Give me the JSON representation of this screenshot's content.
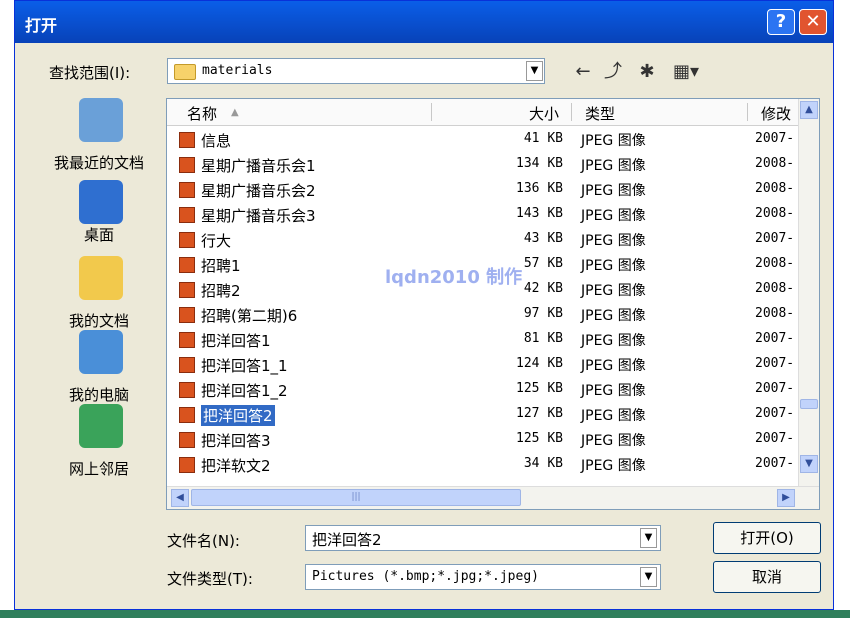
{
  "window": {
    "title": "打开",
    "help_label": "?",
    "close_label": "✕"
  },
  "look_in": {
    "label": "查找范围(I):",
    "value": "materials"
  },
  "toolbar": {
    "back_icon": "back-arrow-icon",
    "up_icon": "up-folder-icon",
    "new_folder_icon": "new-folder-icon",
    "view_icon": "view-menu-icon"
  },
  "places": [
    {
      "label": "我最近的文档",
      "icon": "recent-docs-icon",
      "color": "#6aa0d8"
    },
    {
      "label": "桌面",
      "icon": "desktop-icon",
      "color": "#2f6fd0"
    },
    {
      "label": "我的文档",
      "icon": "my-documents-icon",
      "color": "#f2c94c"
    },
    {
      "label": "我的电脑",
      "icon": "my-computer-icon",
      "color": "#4a8fd8"
    },
    {
      "label": "网上邻居",
      "icon": "network-icon",
      "color": "#3aa35a"
    }
  ],
  "columns": {
    "name": "名称",
    "size": "大小",
    "type": "类型",
    "modified": "修改"
  },
  "files": [
    {
      "name": "信息",
      "size": "41 KB",
      "type": "JPEG 图像",
      "date": "2007-"
    },
    {
      "name": "星期广播音乐会1",
      "size": "134 KB",
      "type": "JPEG 图像",
      "date": "2008-"
    },
    {
      "name": "星期广播音乐会2",
      "size": "136 KB",
      "type": "JPEG 图像",
      "date": "2008-"
    },
    {
      "name": "星期广播音乐会3",
      "size": "143 KB",
      "type": "JPEG 图像",
      "date": "2008-"
    },
    {
      "name": "行大",
      "size": "43 KB",
      "type": "JPEG 图像",
      "date": "2007-"
    },
    {
      "name": "招聘1",
      "size": "57 KB",
      "type": "JPEG 图像",
      "date": "2008-"
    },
    {
      "name": "招聘2",
      "size": "42 KB",
      "type": "JPEG 图像",
      "date": "2008-"
    },
    {
      "name": "招聘(第二期)6",
      "size": "97 KB",
      "type": "JPEG 图像",
      "date": "2008-"
    },
    {
      "name": "把洋回答1",
      "size": "81 KB",
      "type": "JPEG 图像",
      "date": "2007-"
    },
    {
      "name": "把洋回答1_1",
      "size": "124 KB",
      "type": "JPEG 图像",
      "date": "2007-"
    },
    {
      "name": "把洋回答1_2",
      "size": "125 KB",
      "type": "JPEG 图像",
      "date": "2007-"
    },
    {
      "name": "把洋回答2",
      "size": "127 KB",
      "type": "JPEG 图像",
      "date": "2007-",
      "selected": true
    },
    {
      "name": "把洋回答3",
      "size": "125 KB",
      "type": "JPEG 图像",
      "date": "2007-"
    },
    {
      "name": "把洋软文2",
      "size": "34 KB",
      "type": "JPEG 图像",
      "date": "2007-"
    }
  ],
  "watermark": "lqdn2010 制作",
  "filename": {
    "label": "文件名(N):",
    "value": "把洋回答2"
  },
  "filetype": {
    "label": "文件类型(T):",
    "value": "Pictures (*.bmp;*.jpg;*.jpeg)"
  },
  "buttons": {
    "open": "打开(O)",
    "cancel": "取消"
  }
}
